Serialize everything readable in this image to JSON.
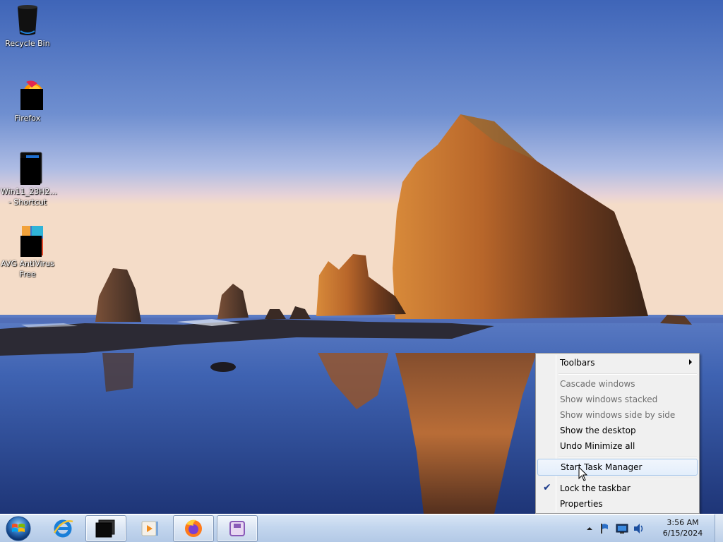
{
  "desktop": {
    "icons": [
      {
        "label": "Recycle Bin",
        "icon": "recycle-bin-icon"
      },
      {
        "label": "Firefox",
        "icon": "firefox-icon"
      },
      {
        "label": "Win11_23H2...\n- Shortcut",
        "icon": "shortcut-icon"
      },
      {
        "label": "AVG AntiVirus\nFree",
        "icon": "avg-antivirus-icon"
      }
    ]
  },
  "taskbar": {
    "start": "windows-start-orb",
    "pinned": [
      {
        "icon": "internet-explorer-icon",
        "open": false
      },
      {
        "icon": "terminal-window-icon",
        "open": true
      },
      {
        "icon": "media-player-icon",
        "open": false
      },
      {
        "icon": "firefox-icon",
        "open": true
      },
      {
        "icon": "app-window-icon",
        "open": true
      }
    ],
    "tray": {
      "icons": [
        "show-hidden-icons-arrow",
        "action-center-flag-icon",
        "network-icon",
        "volume-icon"
      ],
      "time": "3:56 AM",
      "date": "6/15/2024"
    }
  },
  "context_menu": {
    "items": {
      "toolbars": "Toolbars",
      "cascade": "Cascade windows",
      "stacked": "Show windows stacked",
      "side_by_side": "Show windows side by side",
      "show_desktop": "Show the desktop",
      "undo_minimize": "Undo Minimize all",
      "task_manager": "Start Task Manager",
      "lock_taskbar": "Lock the taskbar",
      "properties": "Properties"
    },
    "checked": [
      "lock_taskbar"
    ],
    "disabled": [
      "cascade",
      "stacked",
      "side_by_side"
    ],
    "highlighted": "task_manager"
  },
  "colors": {
    "menu_bg": "#f0f0f0",
    "menu_highlight_border": "#a8c8ec",
    "taskbar_top": "#d9e6f5",
    "sky_top": "#3f65b8",
    "sea": "#2f55a8"
  }
}
